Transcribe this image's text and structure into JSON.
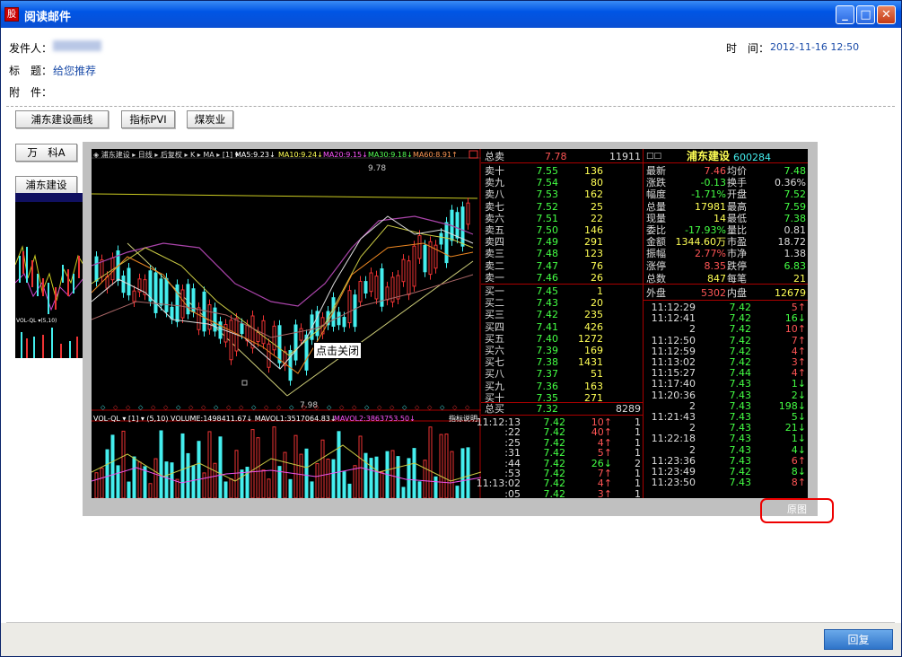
{
  "window": {
    "title": "阅读邮件",
    "app_icon": "股"
  },
  "header": {
    "sender_label": "发件人：",
    "time_label": "时　间：",
    "time_value": "2012-11-16 12:50",
    "subject_label": "标　题：",
    "subject_value": "给您推荐",
    "attach_label": "附　件："
  },
  "toolbar": [
    "浦东建设画线",
    "指标PVI",
    "煤炭业"
  ],
  "side_buttons": [
    "万　科A",
    "浦东建设"
  ],
  "stock": {
    "chart_header": [
      "◈ 浦东建设 ▸ 日线 ▸ 后复权 ▸ K ▸ MA ▸ [1] ▾",
      "MA5:9.23↓",
      "MA10:9.24↓",
      "MA20:9.15↓",
      "MA30:9.18↓",
      "MA60:8.91↑"
    ],
    "price_high": "9.78",
    "price_low": "7.98",
    "vol_header": "VOL-QL ▾ [1] ▾ (5,10) VOLUME:1498411.67↓ MAVOL1:3517064.83↓",
    "mavol2": "MAVOL2:3863753.50↓",
    "indicator_note": "指标说明",
    "sell_total": {
      "label": "总卖",
      "price": "7.78",
      "vol": "11911"
    },
    "sells": [
      {
        "l": "卖十",
        "p": "7.55",
        "v": "136"
      },
      {
        "l": "卖九",
        "p": "7.54",
        "v": "80"
      },
      {
        "l": "卖八",
        "p": "7.53",
        "v": "162"
      },
      {
        "l": "卖七",
        "p": "7.52",
        "v": "25"
      },
      {
        "l": "卖六",
        "p": "7.51",
        "v": "22"
      },
      {
        "l": "卖五",
        "p": "7.50",
        "v": "146"
      },
      {
        "l": "卖四",
        "p": "7.49",
        "v": "291"
      },
      {
        "l": "卖三",
        "p": "7.48",
        "v": "123"
      },
      {
        "l": "卖二",
        "p": "7.47",
        "v": "76"
      },
      {
        "l": "卖一",
        "p": "7.46",
        "v": "26"
      }
    ],
    "buys": [
      {
        "l": "买一",
        "p": "7.45",
        "v": "1"
      },
      {
        "l": "买二",
        "p": "7.43",
        "v": "20"
      },
      {
        "l": "买三",
        "p": "7.42",
        "v": "235"
      },
      {
        "l": "买四",
        "p": "7.41",
        "v": "426"
      },
      {
        "l": "买五",
        "p": "7.40",
        "v": "1272"
      },
      {
        "l": "买六",
        "p": "7.39",
        "v": "169"
      },
      {
        "l": "买七",
        "p": "7.38",
        "v": "1431"
      },
      {
        "l": "买八",
        "p": "7.37",
        "v": "51"
      },
      {
        "l": "买九",
        "p": "7.36",
        "v": "163"
      },
      {
        "l": "买十",
        "p": "7.35",
        "v": "271"
      }
    ],
    "buy_total": {
      "label": "总买",
      "price": "7.32",
      "vol": "8289"
    },
    "name": "浦东建设",
    "code": "600284",
    "stats": [
      [
        "最新",
        "7.46",
        "均价",
        "7.48"
      ],
      [
        "涨跌",
        "-0.13",
        "换手",
        "0.36%"
      ],
      [
        "幅度",
        "-1.71%",
        "开盘",
        "7.52"
      ],
      [
        "总量",
        "17981",
        "最高",
        "7.59"
      ],
      [
        "现量",
        "14",
        "最低",
        "7.38"
      ],
      [
        "委比",
        "-17.93%",
        "量比",
        "0.81"
      ],
      [
        "金额",
        "1344.60万",
        "市盈",
        "18.72"
      ],
      [
        "振幅",
        "2.77%",
        "市净",
        "1.38"
      ],
      [
        "涨停",
        "8.35",
        "跌停",
        "6.83"
      ],
      [
        "总数",
        "847",
        "每笔",
        "21"
      ],
      [
        "外盘",
        "5302",
        "内盘",
        "12679"
      ]
    ],
    "ticks_left": [
      [
        "11:12:13",
        "7.42",
        "10↑",
        "1"
      ],
      [
        ":22",
        "7.42",
        "40↑",
        "1"
      ],
      [
        ":25",
        "7.42",
        "4↑",
        "1"
      ],
      [
        ":31",
        "7.42",
        "5↑",
        "1"
      ],
      [
        ":44",
        "7.42",
        "26↓",
        "2"
      ],
      [
        ":53",
        "7.42",
        "7↑",
        "1"
      ],
      [
        "11:13:02",
        "7.42",
        "4↑",
        "1"
      ],
      [
        ":05",
        "7.42",
        "3↑",
        "1"
      ]
    ],
    "ticks_right": [
      [
        "11:12:29",
        "7.42",
        "5↑"
      ],
      [
        "11:12:41",
        "7.42",
        "16↓"
      ],
      [
        "2",
        "7.42",
        "10↑"
      ],
      [
        "11:12:50",
        "7.42",
        "7↑"
      ],
      [
        "11:12:59",
        "7.42",
        "4↑"
      ],
      [
        "11:13:02",
        "7.42",
        "3↑"
      ],
      [
        "11:15:27",
        "7.44",
        "4↑"
      ],
      [
        "11:17:40",
        "7.43",
        "1↓"
      ],
      [
        "11:20:36",
        "7.43",
        "2↓"
      ],
      [
        "2",
        "7.43",
        "198↓"
      ],
      [
        "11:21:43",
        "7.43",
        "5↓"
      ],
      [
        "2",
        "7.43",
        "21↓"
      ],
      [
        "11:22:18",
        "7.43",
        "1↓"
      ],
      [
        "2",
        "7.43",
        "4↓"
      ],
      [
        "11:23:36",
        "7.43",
        "6↑"
      ],
      [
        "11:23:49",
        "7.42",
        "8↓"
      ],
      [
        "11:23:50",
        "7.43",
        "8↑"
      ]
    ]
  },
  "close_tip": "点击关闭",
  "original_link": "原图",
  "footer": {
    "reply": "回复"
  }
}
